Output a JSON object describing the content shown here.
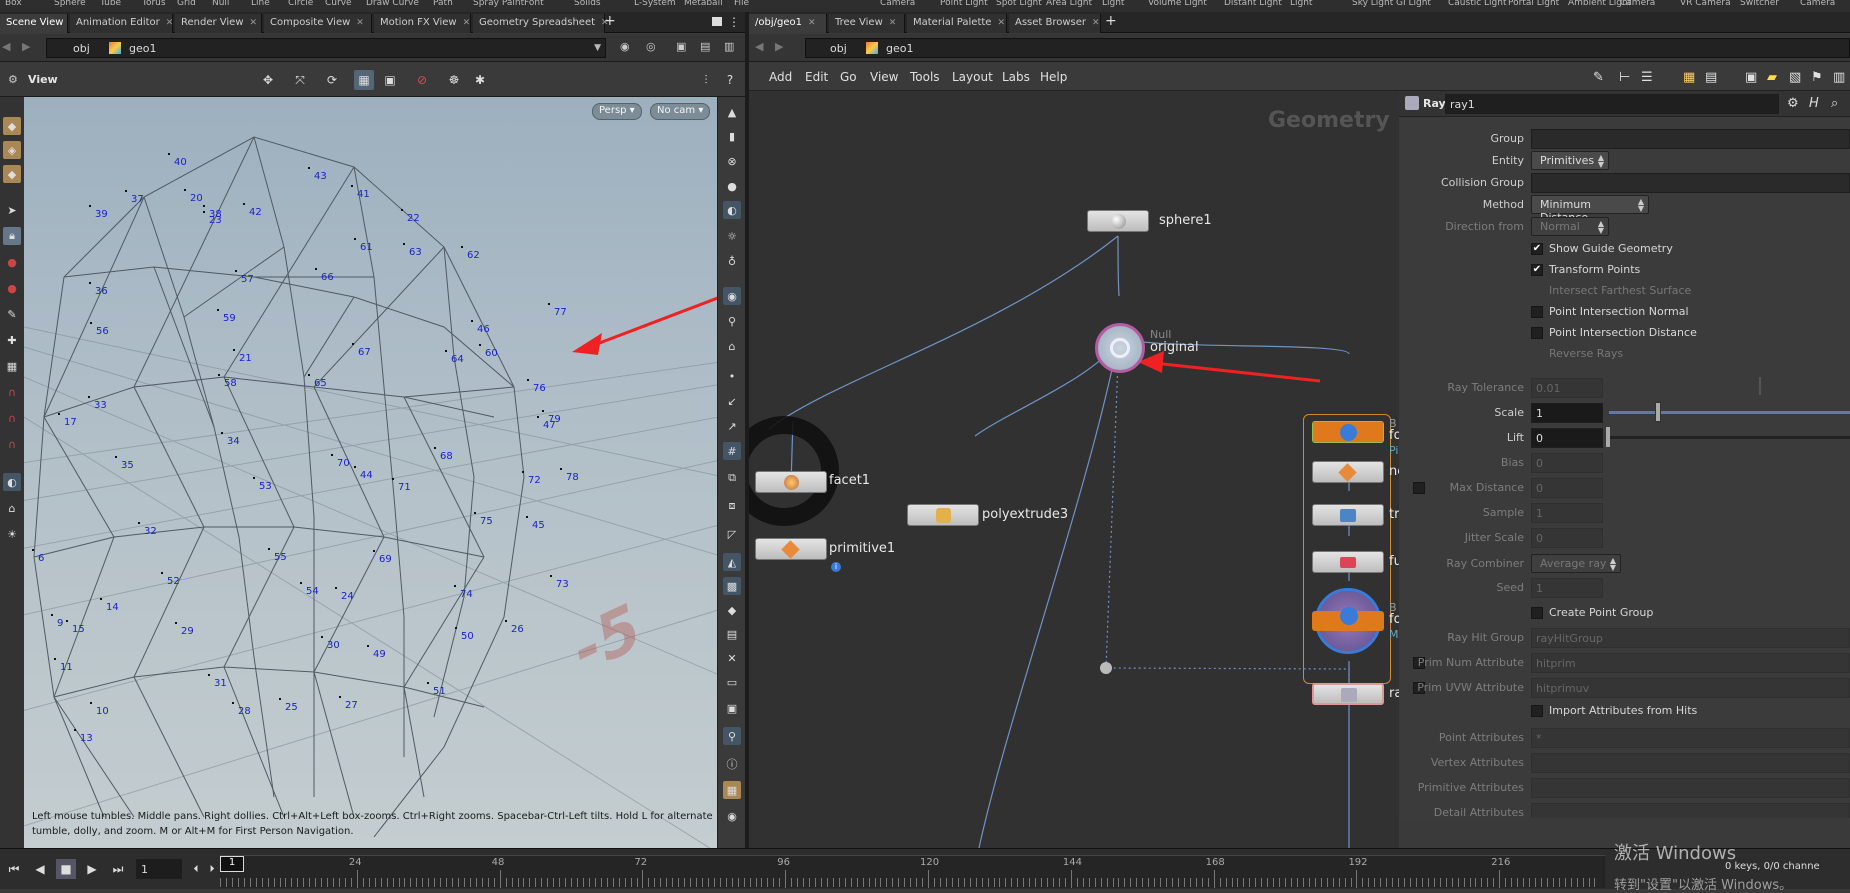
{
  "shelf_tools": [
    "Box",
    "Sphere",
    "Tube",
    "Torus",
    "Grid",
    "Null",
    "Line",
    "Circle",
    "Curve",
    "Draw Curve",
    "Path",
    "Spray Paint",
    "Font",
    "Solids",
    "L-System",
    "Metaball",
    "File",
    "Camera",
    "Point Light",
    "Spot Light",
    "Area Light",
    "Light",
    "Volume Light",
    "Distant Light",
    "Light",
    "Sky Light",
    "GI Light",
    "Caustic Light",
    "Portal Light",
    "Ambient Light",
    "Camera",
    "VR Camera",
    "Switcher",
    "Camera"
  ],
  "left_tabs": [
    {
      "label": "Scene View",
      "active": true
    },
    {
      "label": "Animation Editor",
      "active": false
    },
    {
      "label": "Render View",
      "active": false
    },
    {
      "label": "Composite View",
      "active": false
    },
    {
      "label": "Motion FX View",
      "active": false
    },
    {
      "label": "Geometry Spreadsheet",
      "active": false
    }
  ],
  "right_tabs": [
    {
      "label": "/obj/geo1",
      "active": true
    },
    {
      "label": "Tree View",
      "active": false
    },
    {
      "label": "Material Palette",
      "active": false
    },
    {
      "label": "Asset Browser",
      "active": false
    }
  ],
  "path": {
    "obj": "obj",
    "geo": "geo1"
  },
  "viewport": {
    "title": "View",
    "persp_label": "Persp",
    "cam_label": "No cam",
    "help_text_line1": "Left mouse tumbles. Middle pans. Right dollies. Ctrl+Alt+Left box-zooms. Ctrl+Right zooms. Spacebar-Ctrl-Left tilts. Hold L for alternate",
    "help_text_line2": "tumble, dolly, and zoom.     M or Alt+M for First Person Navigation.",
    "point_numbers": [
      "40",
      "37",
      "20",
      "39",
      "42",
      "43",
      "41",
      "38",
      "23",
      "22",
      "61",
      "63",
      "62",
      "66",
      "57",
      "36",
      "77",
      "59",
      "46",
      "56",
      "67",
      "60",
      "64",
      "21",
      "58",
      "65",
      "76",
      "33",
      "17",
      "47",
      "79",
      "34",
      "68",
      "35",
      "70",
      "44",
      "72",
      "78",
      "53",
      "71",
      "32",
      "75",
      "45",
      "6",
      "69",
      "55",
      "52",
      "73",
      "54",
      "24",
      "74",
      "14",
      "9",
      "15",
      "29",
      "50",
      "26",
      "30",
      "49",
      "11",
      "31",
      "51",
      "25",
      "27",
      "28",
      "10",
      "13"
    ],
    "floor_number": "-5"
  },
  "network": {
    "menu": [
      "Add",
      "Edit",
      "Go",
      "View",
      "Tools",
      "Layout",
      "Labs",
      "Help"
    ],
    "context_label": "Geometry",
    "nodes": [
      {
        "name": "sphere1"
      },
      {
        "name": "original",
        "type": "Null"
      },
      {
        "name": "facet1"
      },
      {
        "name": "primitive1"
      },
      {
        "name": "polyextrude3"
      },
      {
        "name": "fo"
      },
      {
        "name": "ne"
      },
      {
        "name": "tr"
      },
      {
        "name": "fu"
      },
      {
        "name": "fo"
      },
      {
        "name": "ra"
      }
    ],
    "side_labels": [
      "B",
      "Pi",
      "B",
      "M"
    ]
  },
  "parm": {
    "node_type": "Ray",
    "node_name": "ray1",
    "group_label": "Group",
    "group_value": "",
    "entity_label": "Entity",
    "entity_value": "Primitives",
    "collision_label": "Collision Group",
    "collision_value": "",
    "method_label": "Method",
    "method_value": "Minimum Distance",
    "direction_label": "Direction from",
    "direction_value": "Normal",
    "show_guide": "Show Guide Geometry",
    "transform_points": "Transform Points",
    "intersect_farthest": "Intersect Farthest Surface",
    "point_normal": "Point Intersection Normal",
    "point_distance": "Point Intersection Distance",
    "reverse_rays": "Reverse Rays",
    "ray_tolerance_label": "Ray Tolerance",
    "ray_tolerance_value": "0.01",
    "scale_label": "Scale",
    "scale_value": "1",
    "lift_label": "Lift",
    "lift_value": "0",
    "bias_label": "Bias",
    "bias_value": "0",
    "max_distance_label": "Max Distance",
    "max_distance_value": "0",
    "sample_label": "Sample",
    "sample_value": "1",
    "jitter_label": "Jitter Scale",
    "jitter_value": "0",
    "combiner_label": "Ray Combiner",
    "combiner_value": "Average ray",
    "seed_label": "Seed",
    "seed_value": "1",
    "create_group": "Create Point Group",
    "hit_group_label": "Ray Hit Group",
    "hit_group_value": "rayHitGroup",
    "prim_num_label": "Prim Num Attribute",
    "prim_num_value": "hitprim",
    "prim_uvw_label": "Prim UVW Attribute",
    "prim_uvw_value": "hitprimuv",
    "import_attrs": "Import Attributes from Hits",
    "point_attrs_label": "Point Attributes",
    "point_attrs_value": "*",
    "vertex_attrs_label": "Vertex Attributes",
    "prim_attrs_label": "Primitive Attributes",
    "detail_attrs_label": "Detail Attributes"
  },
  "timeline": {
    "frame_value": "1",
    "current_frame": "1",
    "ticks": [
      "24",
      "48",
      "72",
      "96",
      "120",
      "144",
      "168",
      "192",
      "216"
    ],
    "keys_text": "0 keys, 0/0 channe",
    "watermark1": "激活 Windows",
    "watermark2": "转到\"设置\"以激活 Windows。"
  },
  "colors": {
    "accent_arrow": "#ee2222",
    "point_label": "#1a22c8",
    "wire": "#6f93c6"
  }
}
